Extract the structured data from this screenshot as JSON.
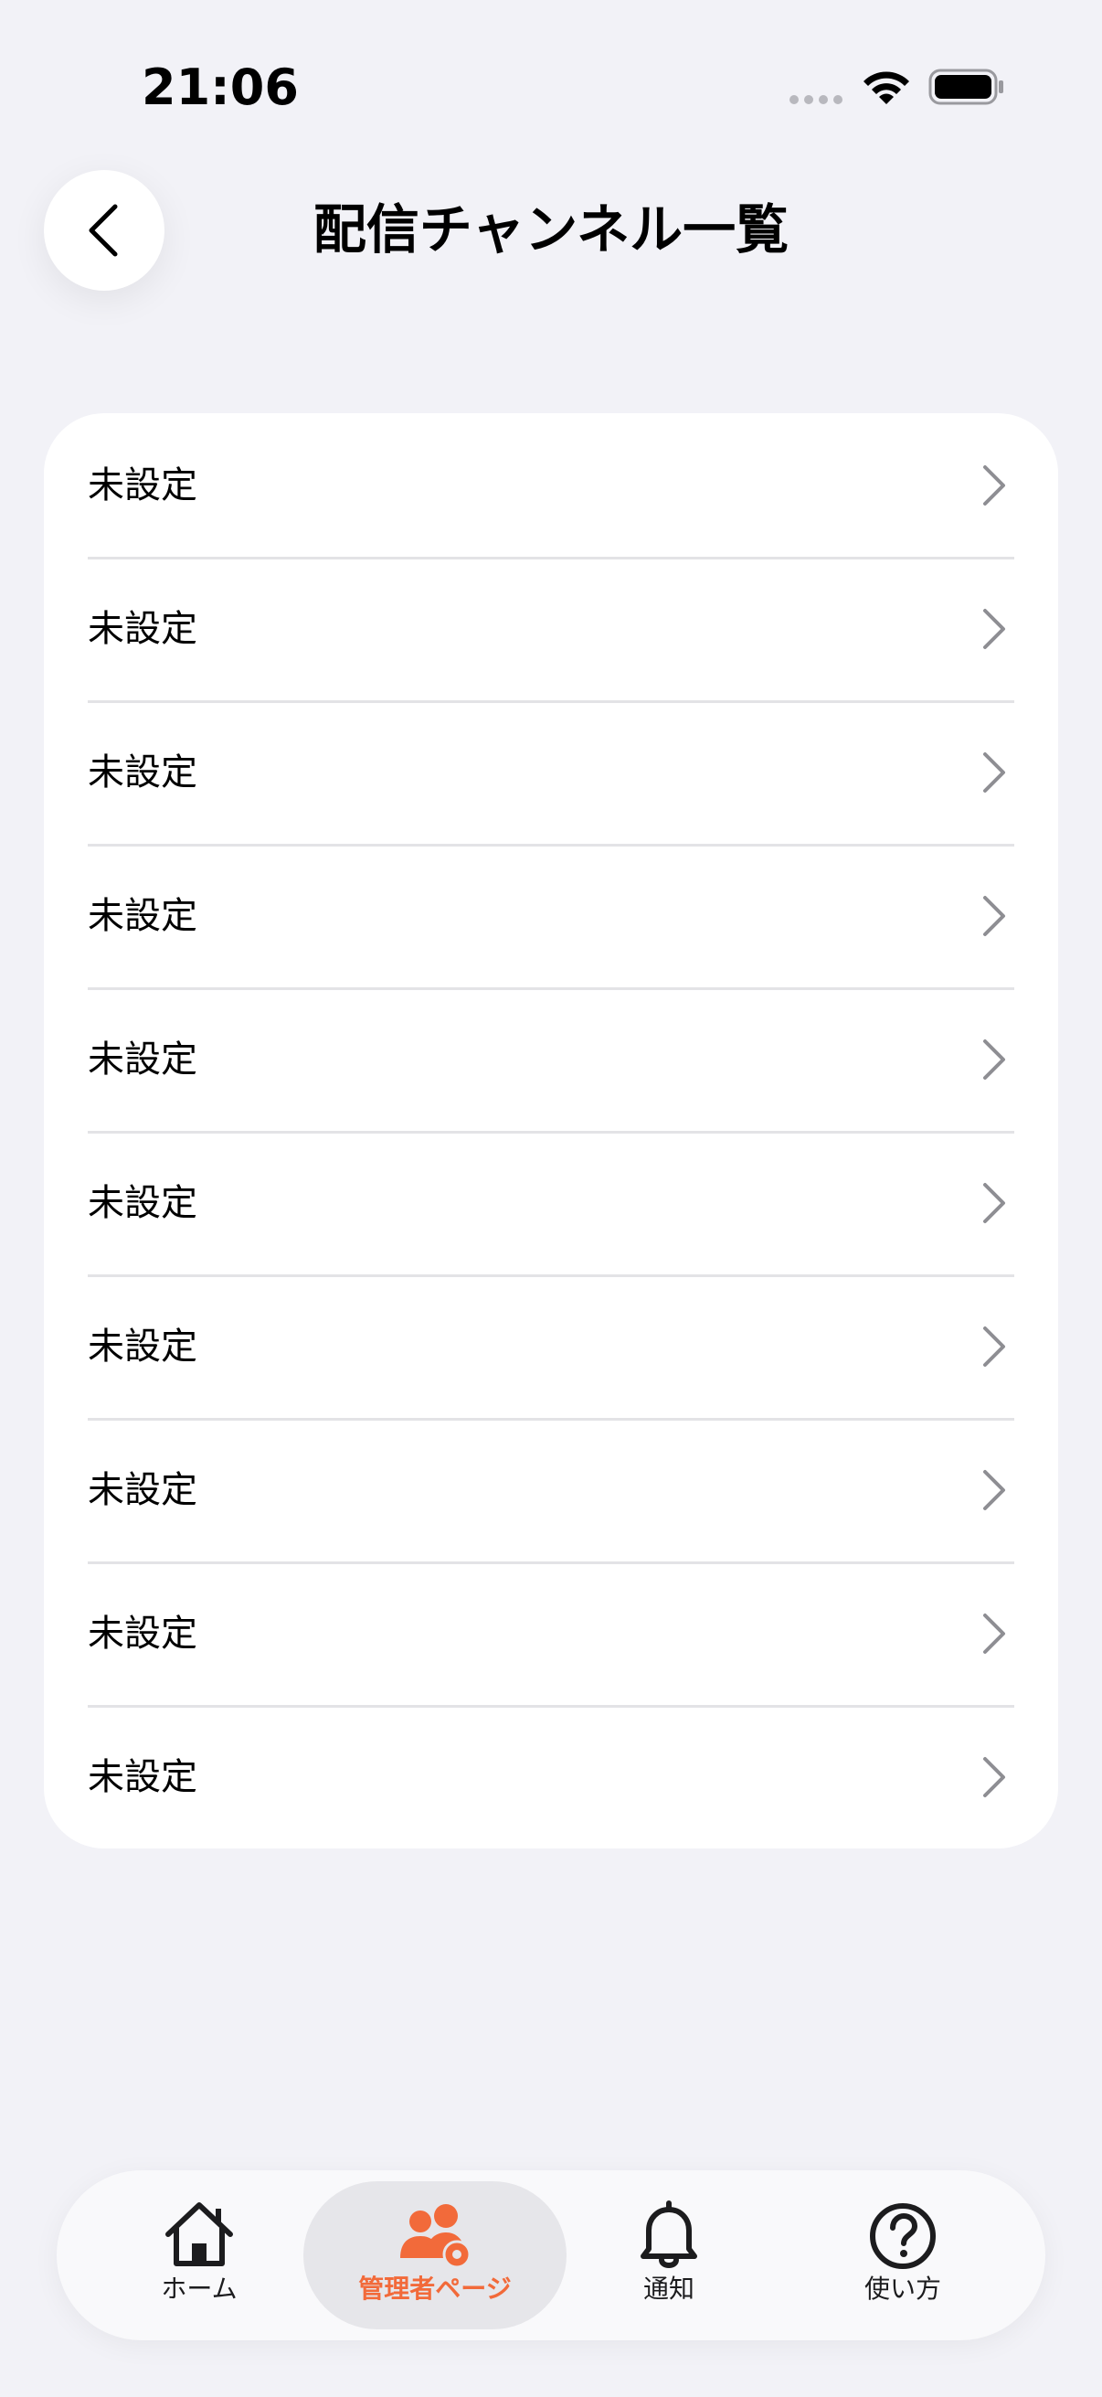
{
  "status_bar": {
    "time": "21:06"
  },
  "header": {
    "title": "配信チャンネル一覧",
    "back_icon": "chevron-left-icon"
  },
  "channels": [
    {
      "label": "未設定"
    },
    {
      "label": "未設定"
    },
    {
      "label": "未設定"
    },
    {
      "label": "未設定"
    },
    {
      "label": "未設定"
    },
    {
      "label": "未設定"
    },
    {
      "label": "未設定"
    },
    {
      "label": "未設定"
    },
    {
      "label": "未設定"
    },
    {
      "label": "未設定"
    }
  ],
  "tab_bar": {
    "tabs": [
      {
        "label": "ホーム",
        "icon": "home-icon",
        "active": false
      },
      {
        "label": "管理者ページ",
        "icon": "admin-users-gear-icon",
        "active": true
      },
      {
        "label": "通知",
        "icon": "bell-icon",
        "active": false
      },
      {
        "label": "使い方",
        "icon": "question-circle-icon",
        "active": false
      }
    ]
  },
  "colors": {
    "background": "#F2F2F7",
    "card": "#FFFFFF",
    "accent": "#F26A3A",
    "separator": "#E3E3E6",
    "chevron": "#8E8E93"
  }
}
